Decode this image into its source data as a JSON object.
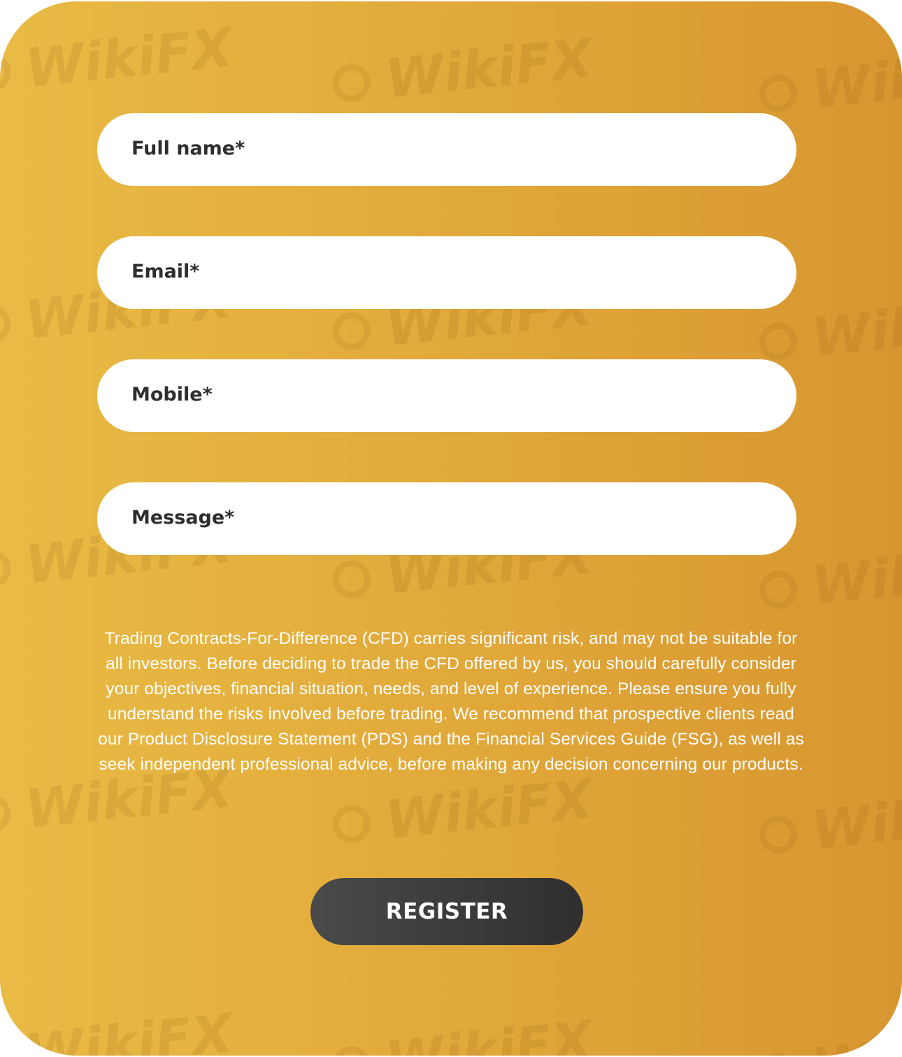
{
  "form": {
    "fields": [
      {
        "label": "Full name*"
      },
      {
        "label": "Email*"
      },
      {
        "label": "Mobile*"
      },
      {
        "label": "Message*"
      }
    ],
    "disclaimer": "Trading Contracts-For-Difference (CFD) carries significant risk, and may not be suitable for all investors. Before deciding to trade the CFD offered by us, you should carefully consider your objectives, financial situation, needs, and level of experience. Please ensure you fully understand the risks involved before trading. We recommend that prospective clients read our Product Disclosure Statement (PDS) and the Financial Services Guide (FSG), as well as seek independent professional advice, before making any decision concerning our products.",
    "submit_label": "REGISTER"
  },
  "watermark": {
    "text": "WikiFX"
  },
  "colors": {
    "background_start": "#e9bb45",
    "background_end": "#d89630",
    "field_background": "#ffffff",
    "button_background": "#3a3a3a",
    "text_dark": "#2e2e2e"
  }
}
